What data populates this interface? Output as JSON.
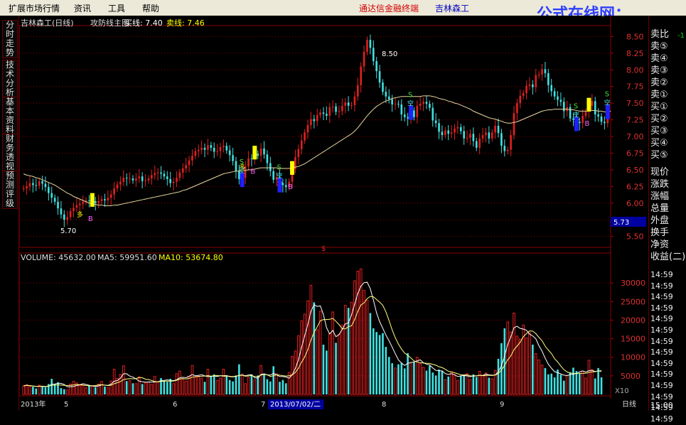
{
  "menubar": {
    "items": [
      "扩展市场行情",
      "资讯",
      "工具",
      "帮助"
    ],
    "brand_terminal": "通达信金融终端",
    "brand_stock": "吉林森工",
    "watermark": "公式在线网：www.gszx.com.cn"
  },
  "sidebar": {
    "tabs": [
      "分时走势",
      "技术分析",
      "基本资料",
      "财务透视",
      "预测评级"
    ]
  },
  "chart_header": {
    "name": "吉林森工(日线)",
    "indicator": "攻防线主图",
    "buy_label": "买线: 7.40",
    "sell_label": "卖线: 7.46"
  },
  "volume_header": {
    "volume": "VOLUME: 45632.00",
    "ma5": "MA5: 59951.60",
    "ma10": "MA10: 53674.80"
  },
  "price_axis": [
    "8.50",
    "8.25",
    "8.00",
    "7.75",
    "7.50",
    "7.25",
    "7.00",
    "6.75",
    "6.50",
    "6.25",
    "6.00",
    "5.75",
    "5.50"
  ],
  "current_price": "5.73",
  "volume_axis": [
    "30000",
    "25000",
    "20000",
    "15000",
    "10000",
    "5000"
  ],
  "volume_unit": "X10",
  "price_markers": {
    "high": "8.50",
    "low": "5.70"
  },
  "signal_labels": {
    "buy": "B",
    "sell": "S",
    "long": "多",
    "short": "空",
    "dollar": "$"
  },
  "date_axis": {
    "year": "2013年",
    "months": [
      "5",
      "6",
      "7",
      "8",
      "9"
    ],
    "cursor_date": "2013/07/02/二",
    "period": "日线"
  },
  "right_panel": {
    "quote_labels": [
      "卖比",
      "卖⑤",
      "卖④",
      "卖③",
      "卖②",
      "卖①",
      "买①",
      "买②",
      "买③",
      "买④",
      "买⑤",
      "现价",
      "涨跌",
      "涨幅",
      "总量",
      "外盘",
      "换手",
      "净资",
      "收益(二)"
    ],
    "quote_value": "-1",
    "times": [
      "14:59",
      "14:59",
      "14:59",
      "14:59",
      "14:59",
      "14:59",
      "14:59",
      "14:59",
      "14:59",
      "14:59",
      "14:59",
      "14:59",
      "14:59",
      "14:59"
    ],
    "last_time": "15:00"
  },
  "colors": {
    "up": "#e02020",
    "down": "#40e0e0",
    "ma": "#e8d8a0",
    "buy_signal": "#ffff00",
    "sell_signal": "#2020ff"
  },
  "chart_data": {
    "type": "candlestick",
    "price_range": [
      5.4,
      8.6
    ],
    "volume_range": [
      0,
      35000
    ],
    "closes": [
      6.22,
      6.25,
      6.3,
      6.27,
      6.26,
      6.33,
      6.29,
      6.24,
      6.15,
      6.08,
      6.02,
      5.92,
      5.83,
      5.75,
      5.79,
      5.88,
      5.93,
      5.97,
      5.99,
      6.02,
      6.04,
      6.03,
      6.03,
      6.0,
      6.03,
      6.06,
      6.04,
      6.08,
      6.13,
      6.22,
      6.28,
      6.32,
      6.38,
      6.37,
      6.37,
      6.34,
      6.37,
      6.4,
      6.33,
      6.34,
      6.37,
      6.42,
      6.45,
      6.46,
      6.44,
      6.4,
      6.36,
      6.3,
      6.32,
      6.38,
      6.46,
      6.52,
      6.57,
      6.64,
      6.71,
      6.78,
      6.8,
      6.83,
      6.8,
      6.87,
      6.83,
      6.77,
      6.78,
      6.84,
      6.86,
      6.79,
      6.72,
      6.63,
      6.48,
      6.36,
      6.38,
      6.55,
      6.67,
      6.66,
      6.74,
      6.71,
      6.82,
      6.73,
      6.6,
      6.48,
      6.35,
      6.39,
      6.3,
      6.27,
      6.24,
      6.32,
      6.51,
      6.69,
      6.81,
      6.94,
      7.06,
      7.17,
      7.26,
      7.23,
      7.32,
      7.36,
      7.34,
      7.31,
      7.44,
      7.45,
      7.37,
      7.38,
      7.46,
      7.51,
      7.46,
      7.47,
      7.6,
      7.77,
      8.05,
      8.27,
      8.45,
      8.33,
      8.13,
      7.98,
      7.81,
      7.67,
      7.6,
      7.56,
      7.48,
      7.49,
      7.48,
      7.33,
      7.29,
      7.27,
      7.39,
      7.29,
      7.46,
      7.49,
      7.52,
      7.49,
      7.43,
      7.24,
      7.2,
      7.07,
      7.02,
      7.09,
      7.04,
      7.06,
      7.12,
      7.14,
      7.08,
      6.97,
      6.98,
      7.04,
      6.93,
      6.83,
      6.97,
      7.02,
      7.06,
      6.97,
      7.06,
      7.16,
      7.05,
      6.86,
      6.78,
      6.8,
      7.02,
      7.35,
      7.5,
      7.61,
      7.65,
      7.76,
      7.78,
      7.74,
      7.92,
      7.93,
      8.01,
      7.95,
      7.77,
      7.68,
      7.6,
      7.55,
      7.52,
      7.38,
      7.44,
      7.27,
      7.25,
      7.22,
      7.2,
      7.31,
      7.37,
      7.46,
      7.53,
      7.33,
      7.3,
      7.22,
      7.2,
      7.4
    ],
    "volumes": [
      2300,
      2600,
      2200,
      2100,
      1600,
      2500,
      2300,
      1900,
      2800,
      4200,
      2800,
      3300,
      1700,
      1400,
      1200,
      2800,
      3500,
      3100,
      2400,
      2600,
      1800,
      2400,
      2200,
      2000,
      2800,
      3500,
      2100,
      1800,
      3600,
      6800,
      4300,
      5400,
      7700,
      3600,
      3700,
      3000,
      2900,
      4700,
      2800,
      3100,
      3300,
      2700,
      4800,
      3300,
      4400,
      3700,
      3400,
      4200,
      2900,
      5600,
      6300,
      4100,
      3600,
      4900,
      7800,
      4700,
      4700,
      4400,
      3400,
      6800,
      4800,
      5400,
      3800,
      4400,
      6800,
      5000,
      3900,
      3500,
      5100,
      8100,
      5500,
      2900,
      4600,
      5400,
      4000,
      5100,
      7800,
      5400,
      4100,
      3500,
      7600,
      5600,
      3400,
      3900,
      3000,
      5900,
      10200,
      11700,
      15800,
      19800,
      21600,
      25200,
      29400,
      24800,
      17400,
      22400,
      13400,
      11800,
      16400,
      22200,
      13900,
      16200,
      18700,
      24000,
      23300,
      24800,
      30600,
      33200,
      33800,
      28000,
      25400,
      21900,
      17800,
      16800,
      16000,
      16500,
      12800,
      10100,
      8400,
      7100,
      8100,
      8500,
      7000,
      11100,
      8400,
      8700,
      10000,
      8300,
      7300,
      6400,
      7700,
      5900,
      5100,
      6700,
      6300,
      4000,
      4800,
      6100,
      5300,
      3800,
      5000,
      5300,
      5600,
      4000,
      5400,
      4700,
      6200,
      5200,
      5800,
      4500,
      4200,
      6500,
      9600,
      13800,
      17800,
      19500,
      16800,
      21900,
      15700,
      14900,
      18700,
      15200,
      16600,
      13400,
      11000,
      9300,
      7900,
      7100,
      5400,
      5600,
      4600,
      6700,
      5300,
      3700,
      5100,
      6000,
      7200,
      6300,
      5800,
      6300,
      4400,
      9200,
      6700,
      4300,
      7100,
      4600
    ],
    "ma_line": [
      6.44,
      6.42,
      6.41,
      6.4,
      6.38,
      6.37,
      6.35,
      6.33,
      6.31,
      6.29,
      6.27,
      6.24,
      6.21,
      6.18,
      6.15,
      6.13,
      6.1,
      6.08,
      6.06,
      6.04,
      6.02,
      6.0,
      5.99,
      5.98,
      5.97,
      5.97,
      5.96,
      5.96,
      5.96,
      5.97,
      5.97,
      5.98,
      5.99,
      6.0,
      6.01,
      6.02,
      6.03,
      6.04,
      6.05,
      6.06,
      6.07,
      6.08,
      6.09,
      6.1,
      6.11,
      6.12,
      6.13,
      6.14,
      6.15,
      6.16,
      6.17,
      6.19,
      6.2,
      6.22,
      6.24,
      6.26,
      6.28,
      6.3,
      6.32,
      6.34,
      6.36,
      6.38,
      6.4,
      6.42,
      6.44,
      6.45,
      6.46,
      6.47,
      6.48,
      6.48,
      6.48,
      6.49,
      6.5,
      6.5,
      6.51,
      6.52,
      6.53,
      6.53,
      6.53,
      6.53,
      6.53,
      6.53,
      6.52,
      6.52,
      6.52,
      6.52,
      6.53,
      6.54,
      6.55,
      6.57,
      6.59,
      6.62,
      6.65,
      6.68,
      6.71,
      6.74,
      6.77,
      6.8,
      6.83,
      6.86,
      6.89,
      6.92,
      6.95,
      6.98,
      7.01,
      7.04,
      7.08,
      7.13,
      7.19,
      7.25,
      7.31,
      7.36,
      7.41,
      7.45,
      7.48,
      7.51,
      7.53,
      7.55,
      7.57,
      7.58,
      7.59,
      7.6,
      7.6,
      7.6,
      7.6,
      7.6,
      7.6,
      7.6,
      7.61,
      7.61,
      7.61,
      7.6,
      7.59,
      7.57,
      7.56,
      7.55,
      7.53,
      7.52,
      7.5,
      7.49,
      7.47,
      7.45,
      7.43,
      7.41,
      7.38,
      7.36,
      7.34,
      7.32,
      7.3,
      7.28,
      7.27,
      7.26,
      7.24,
      7.23,
      7.21,
      7.2,
      7.2,
      7.21,
      7.22,
      7.24,
      7.26,
      7.28,
      7.3,
      7.32,
      7.34,
      7.36,
      7.38,
      7.39,
      7.4,
      7.4,
      7.41,
      7.41,
      7.41,
      7.41,
      7.41,
      7.4,
      7.4,
      7.39,
      7.38,
      7.38,
      7.38,
      7.38,
      7.39,
      7.39,
      7.38,
      7.38,
      7.37,
      7.37,
      7.38
    ]
  }
}
